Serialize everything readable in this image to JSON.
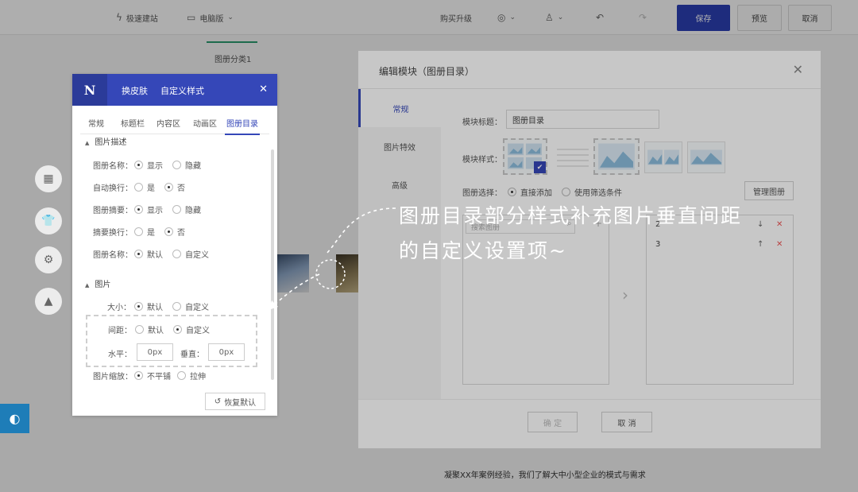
{
  "topbar": {
    "quick_build": "极速建站",
    "device": "电脑版",
    "buy_upgrade": "购买升级",
    "save": "保存",
    "preview": "预览",
    "cancel": "取消"
  },
  "canvas": {
    "category_tab": "图册分类1",
    "footer_text": "凝聚XX年案例经验，我们了解大中小型企业的模式与需求"
  },
  "style_panel": {
    "logo": "N",
    "header_tabs": [
      "换皮肤",
      "自定义样式"
    ],
    "tabs": [
      "常规",
      "标题栏",
      "内容区",
      "动画区",
      "图册目录"
    ],
    "active_tab": "图册目录",
    "section_image_desc": "图片描述",
    "rows": [
      {
        "label": "图册名称：",
        "opt1": "显示",
        "opt2": "隐藏"
      },
      {
        "label": "自动换行：",
        "opt1": "是",
        "opt2": "否"
      },
      {
        "label": "图册摘要：",
        "opt1": "显示",
        "opt2": "隐藏"
      },
      {
        "label": "摘要换行：",
        "opt1": "是",
        "opt2": "否"
      },
      {
        "label": "图册名称：",
        "opt1": "默认",
        "opt2": "自定义"
      }
    ],
    "section_image": "图片",
    "size_label": "大小：",
    "size_opt1": "默认",
    "size_opt2": "自定义",
    "spacing_label": "间距：",
    "spacing_opt1": "默认",
    "spacing_opt2": "自定义",
    "horizontal_label": "水平：",
    "horizontal_value": "0px",
    "vertical_label": "垂直：",
    "vertical_value": "0px",
    "scale_label": "图片缩放：",
    "scale_opt1": "不平铺",
    "scale_opt2": "拉伸",
    "reset": "恢复默认"
  },
  "dialog": {
    "title": "编辑模块（图册目录）",
    "nav": [
      "常规",
      "图片特效",
      "高级"
    ],
    "module_title_label": "模块标题：",
    "module_title_value": "图册目录",
    "module_style_label": "模块样式：",
    "album_select_label": "图册选择：",
    "album_opt1": "直接添加",
    "album_opt2": "使用筛选条件",
    "manage_albums": "管理图册",
    "search_placeholder": "搜索图册",
    "right_list": [
      "2",
      "3"
    ],
    "confirm": "确 定",
    "cancel": "取 消"
  },
  "annotation": {
    "line1": "图册目录部分样式补充图片垂直间距",
    "line2": "的自定义设置项~"
  }
}
